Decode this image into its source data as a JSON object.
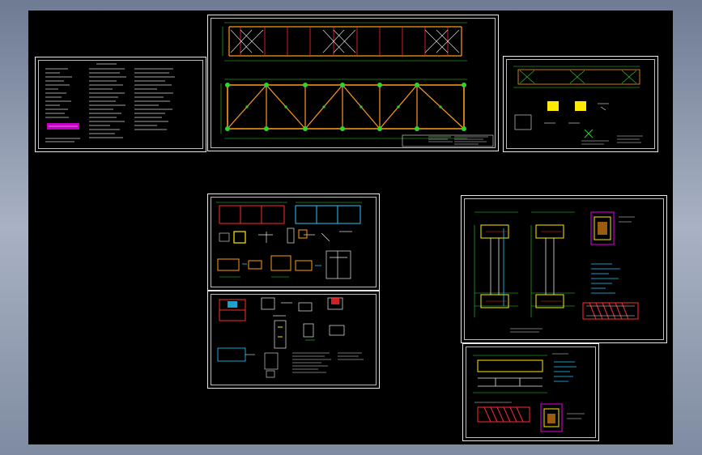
{
  "app": {
    "title": "",
    "view": "model-space"
  },
  "colors": {
    "background": "#000000",
    "frame": "#e8e8e8",
    "truss_chord": "#ff9a1a",
    "truss_member": "#2fd52f",
    "section_red": "#ff2a2a",
    "note_cyan": "#27c7ff",
    "highlight_yellow": "#ffea00",
    "title_magenta": "#c100c1"
  },
  "sheets": [
    {
      "id": "general-notes",
      "kind": "text-notes"
    },
    {
      "id": "truss-elevation",
      "kind": "truss"
    },
    {
      "id": "bracing-plan",
      "kind": "plan-details"
    },
    {
      "id": "connection-details-a",
      "kind": "details"
    },
    {
      "id": "connection-details-b",
      "kind": "details"
    },
    {
      "id": "column-details",
      "kind": "details"
    },
    {
      "id": "support-details",
      "kind": "details"
    }
  ]
}
